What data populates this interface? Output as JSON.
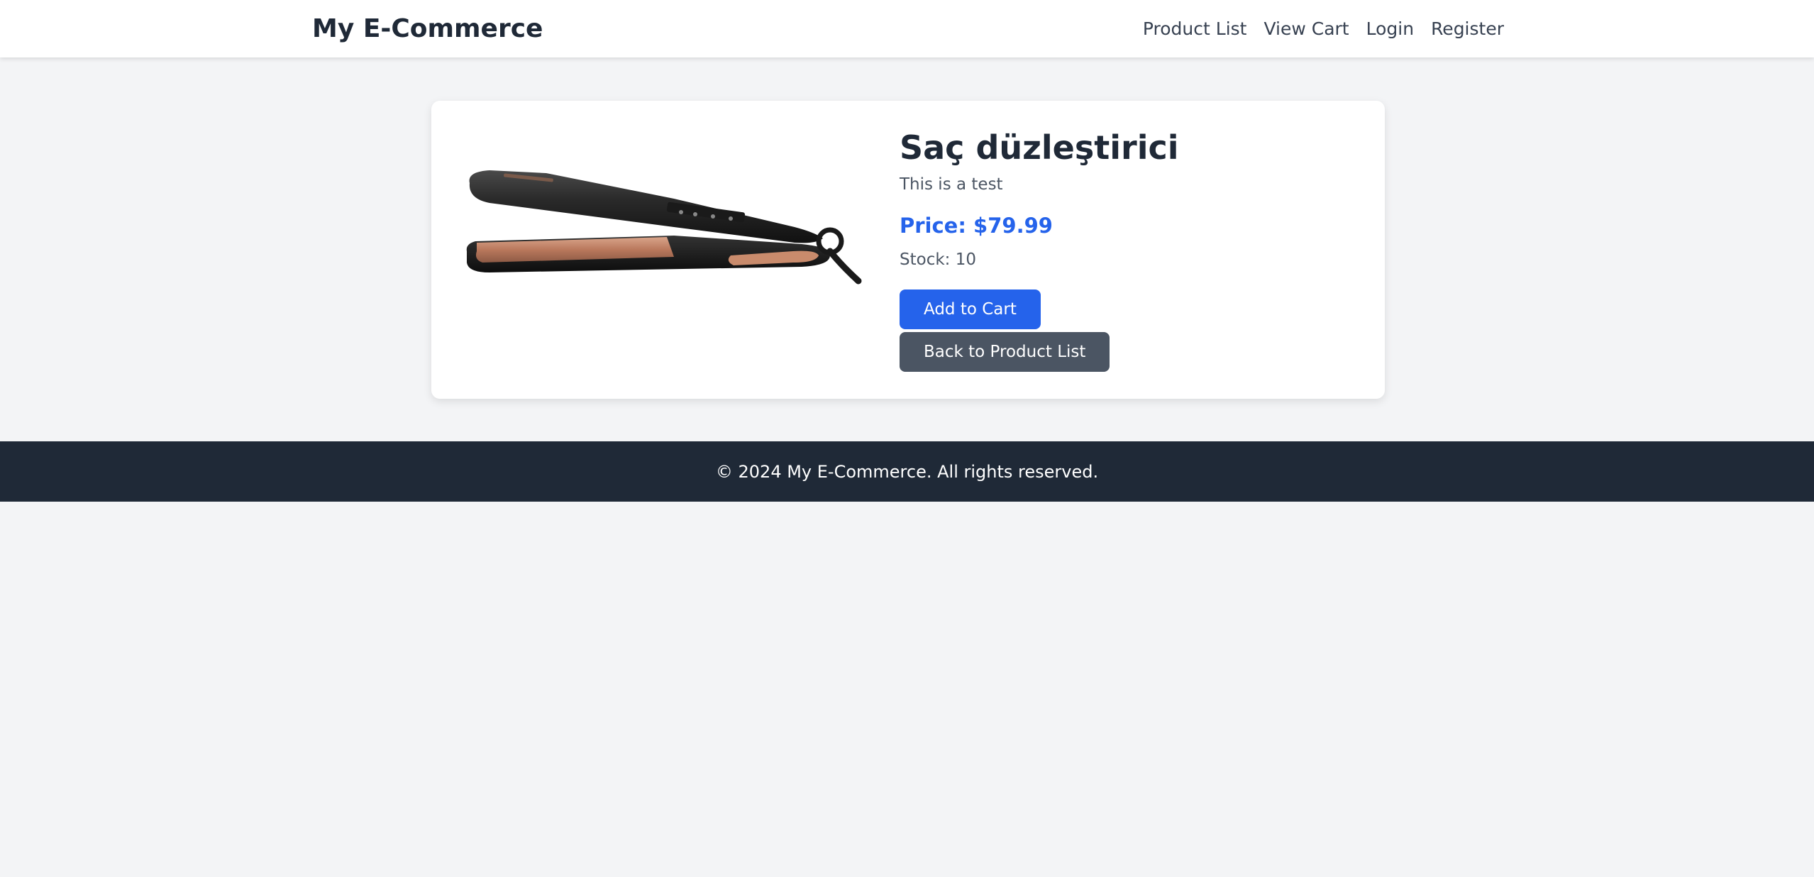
{
  "header": {
    "brand": "My E-Commerce",
    "nav": [
      {
        "label": "Product List"
      },
      {
        "label": "View Cart"
      },
      {
        "label": "Login"
      },
      {
        "label": "Register"
      }
    ]
  },
  "product": {
    "title": "Saç düzleştirici",
    "description": "This is a test",
    "price": "Price: $79.99",
    "stock": "Stock: 10",
    "image_alt_icon": "hair-straightener-image"
  },
  "actions": {
    "add_to_cart": "Add to Cart",
    "back_to_list": "Back to Product List"
  },
  "footer": {
    "text": "© 2024 My E-Commerce. All rights reserved."
  },
  "colors": {
    "accent": "#2563eb",
    "secondary_button": "#4b5563",
    "footer_bg": "#1f2937",
    "page_bg": "#f3f4f6"
  }
}
